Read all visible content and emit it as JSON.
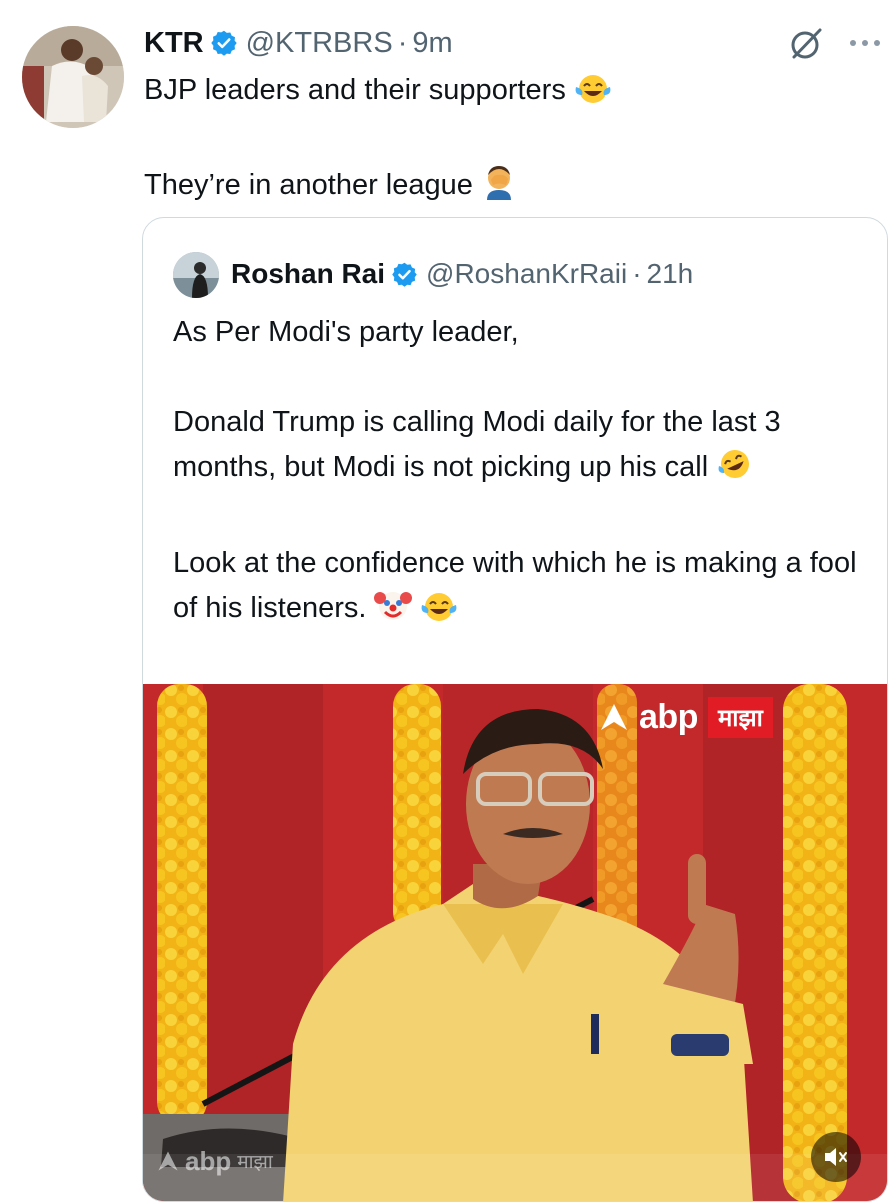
{
  "tweet": {
    "author_name": "KTR",
    "handle": "@KTRBRS",
    "separator": "·",
    "time": "9m",
    "line1": "BJP leaders and their supporters",
    "line2": "They’re in another league",
    "line1_emoji": "face-with-tears-of-joy",
    "line2_emoji": "man-facepalming"
  },
  "quoted_tweet": {
    "author_name": "Roshan Rai",
    "handle": "@RoshanKrRaii",
    "separator": "·",
    "time": "21h",
    "para1": "As Per Modi's party leader,",
    "para2": "Donald Trump is calling Modi daily for the last 3 months, but Modi is not picking up his call",
    "para3": "Look at the confidence with which he is making a fool of his listeners.",
    "para2_emoji": "rolling-on-the-floor-laughing",
    "para3_emojis": [
      "clown-face",
      "face-with-tears-of-joy"
    ]
  },
  "media": {
    "logo_top_abp": "abp",
    "logo_top_majha": "माझा",
    "logo_bottom_abp": "abp",
    "logo_bottom_majha": "माझा",
    "mute_state": "muted"
  },
  "icons": {
    "verified": "verified-badge-icon",
    "grok": "grok-icon",
    "more": "more-options-icon",
    "mute": "volume-muted-icon"
  },
  "colors": {
    "verified_blue": "#1d9bf0",
    "text_primary": "#0f1419",
    "text_secondary": "#536471",
    "border": "#cfd9de",
    "stage_red": "#c3292a",
    "shirt_yellow": "#f3d371",
    "marigold": "#f7c51f"
  }
}
